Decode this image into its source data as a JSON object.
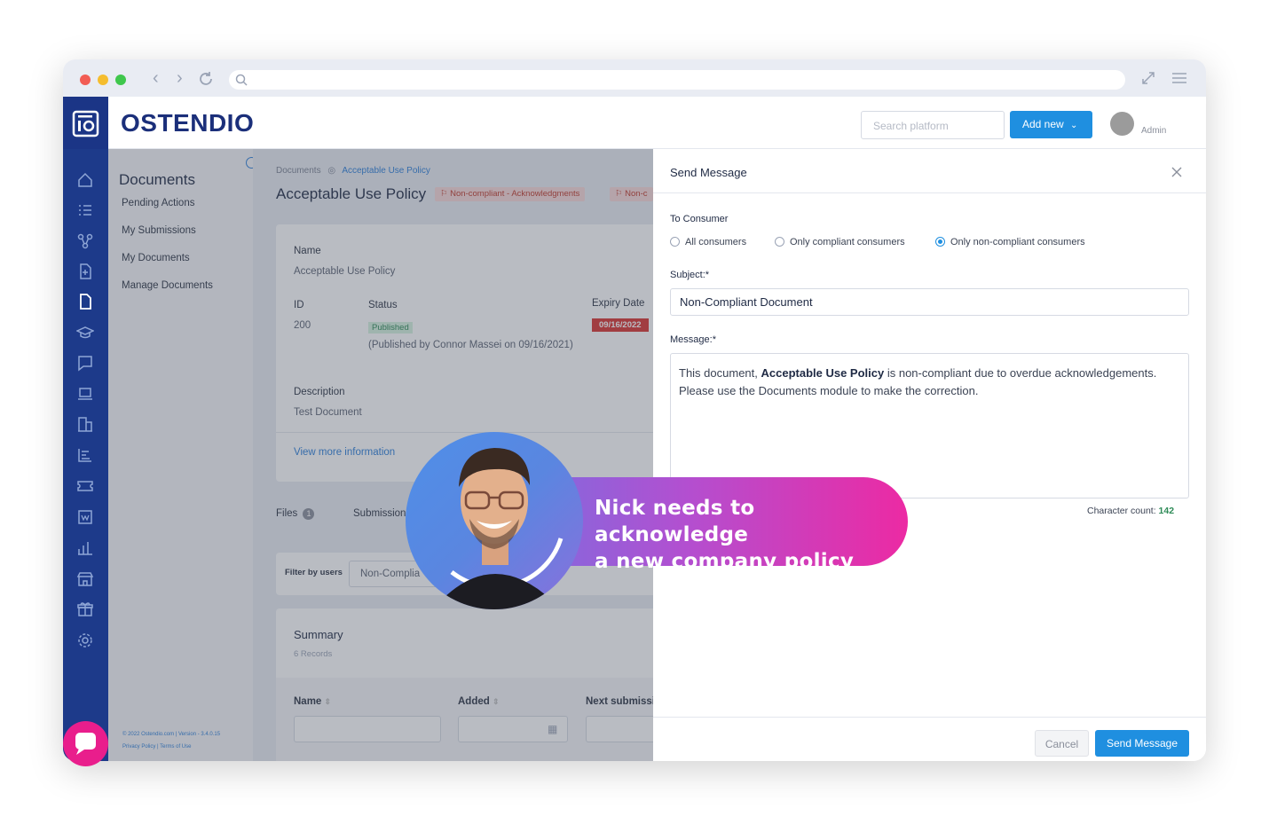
{
  "browser": {
    "url": ""
  },
  "header": {
    "brand": "OSTENDIO",
    "search_placeholder": "Search platform",
    "add_new_label": "Add new",
    "user_label": "Admin"
  },
  "sidebar_icons": [
    "home-icon",
    "checklist-icon",
    "network-icon",
    "file-add-icon",
    "document-icon",
    "graduation-icon",
    "chat-square-icon",
    "laptop-icon",
    "building-icon",
    "bar-chart-icon",
    "ticket-icon",
    "badge-icon",
    "analytics-icon",
    "store-icon",
    "gift-icon",
    "gear-icon"
  ],
  "subnav": {
    "title": "Documents",
    "items": [
      "Pending Actions",
      "My Submissions",
      "My Documents",
      "Manage Documents"
    ],
    "footer_line1": "© 2022 Ostendio.com | Version - 3.4.0.15",
    "footer_line2": "Privacy Policy | Terms of Use"
  },
  "document": {
    "breadcrumb_root": "Documents",
    "breadcrumb_current": "Acceptable Use Policy",
    "title": "Acceptable Use Policy",
    "tag1": "Non-compliant - Acknowledgments",
    "tag2": "Non-c",
    "name_label": "Name",
    "name_value": "Acceptable Use Policy",
    "id_label": "ID",
    "id_value": "200",
    "status_label": "Status",
    "status_value": "Published",
    "status_note": "(Published by Connor Massei on 09/16/2021)",
    "expiry_label": "Expiry Date",
    "expiry_value": "09/16/2022",
    "description_label": "Description",
    "description_value": "Test Document",
    "view_more": "View more information",
    "tab_files": "Files",
    "tab_files_count": "1",
    "tab_submissions": "Submission",
    "filter_label": "Filter by users",
    "filter_value": "Non-Complia",
    "summary_title": "Summary",
    "summary_count": "6 Records",
    "col_name": "Name",
    "col_added": "Added",
    "col_next": "Next submissi"
  },
  "modal": {
    "title": "Send Message",
    "to_label": "To Consumer",
    "radio_all": "All consumers",
    "radio_compliant": "Only compliant consumers",
    "radio_noncompliant": "Only non-compliant consumers",
    "subject_label": "Subject:*",
    "subject_value": "Non-Compliant Document",
    "message_label": "Message:*",
    "message_pre": "This document, ",
    "message_bold": "Acceptable Use Policy",
    "message_post": " is non-compliant due to overdue acknowledgements.",
    "message_line2": "Please use the Documents module to make the correction.",
    "char_label": "Character count: ",
    "char_value": "142",
    "cancel": "Cancel",
    "send": "Send Message"
  },
  "callout": {
    "line1": "Nick needs to acknowledge",
    "line2": "a new company policy"
  },
  "colors": {
    "brand_blue": "#1d3a8a",
    "accent": "#1f8fe0",
    "pink": "#e91e8c"
  }
}
